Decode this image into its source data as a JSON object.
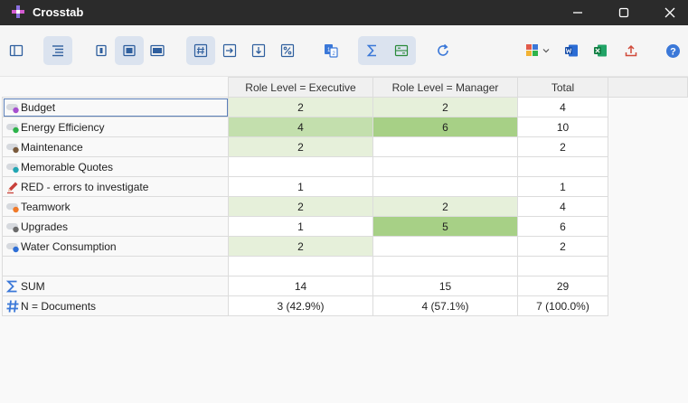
{
  "window": {
    "title": "Crosstab"
  },
  "table": {
    "columns": [
      "Role Level = Executive",
      "Role Level = Manager",
      "Total"
    ],
    "rows": [
      {
        "label": "Budget",
        "values": [
          "2",
          "2",
          "4"
        ],
        "icon": "code-toggle-icon",
        "dot": "#a64fcf",
        "shade": [
          "h1",
          "h1",
          "cell"
        ]
      },
      {
        "label": "Energy Efficiency",
        "values": [
          "4",
          "6",
          "10"
        ],
        "icon": "code-toggle-icon",
        "dot": "#2db34a",
        "shade": [
          "h3",
          "h2",
          "cell"
        ]
      },
      {
        "label": "Maintenance",
        "values": [
          "2",
          "",
          "2"
        ],
        "icon": "code-toggle-icon",
        "dot": "#7a5a3c",
        "shade": [
          "h1",
          "blank",
          "cell"
        ]
      },
      {
        "label": "Memorable Quotes",
        "values": [
          "",
          "",
          ""
        ],
        "icon": "code-toggle-icon",
        "dot": "#22a6b3",
        "shade": [
          "blank",
          "blank",
          "cell"
        ]
      },
      {
        "label": "RED - errors to investigate",
        "values": [
          "1",
          "",
          "1"
        ],
        "icon": "pencil-icon",
        "dot": "#d63a3a",
        "shade": [
          "cell",
          "blank",
          "cell"
        ]
      },
      {
        "label": "Teamwork",
        "values": [
          "2",
          "2",
          "4"
        ],
        "icon": "code-toggle-icon",
        "dot": "#f07a2a",
        "shade": [
          "h1",
          "h1",
          "cell"
        ]
      },
      {
        "label": "Upgrades",
        "values": [
          "1",
          "5",
          "6"
        ],
        "icon": "code-toggle-icon",
        "dot": "#6b6b6b",
        "shade": [
          "cell",
          "h2",
          "cell"
        ]
      },
      {
        "label": "Water Consumption",
        "values": [
          "2",
          "",
          "2"
        ],
        "icon": "code-toggle-icon",
        "dot": "#2f6fd6",
        "shade": [
          "h1",
          "blank",
          "cell"
        ]
      }
    ],
    "summary": [
      {
        "label": "SUM",
        "values": [
          "14",
          "15",
          "29"
        ],
        "icon": "sigma-icon"
      },
      {
        "label": "N = Documents",
        "values": [
          "3 (42.9%)",
          "4 (57.1%)",
          "7 (100.0%)"
        ],
        "icon": "hash-icon"
      }
    ]
  },
  "colors": {
    "titlebar": "#2b2b2b",
    "accent": "#3b78d8",
    "highlight_dark": "#a7d086",
    "highlight_light": "#e6f0da"
  }
}
